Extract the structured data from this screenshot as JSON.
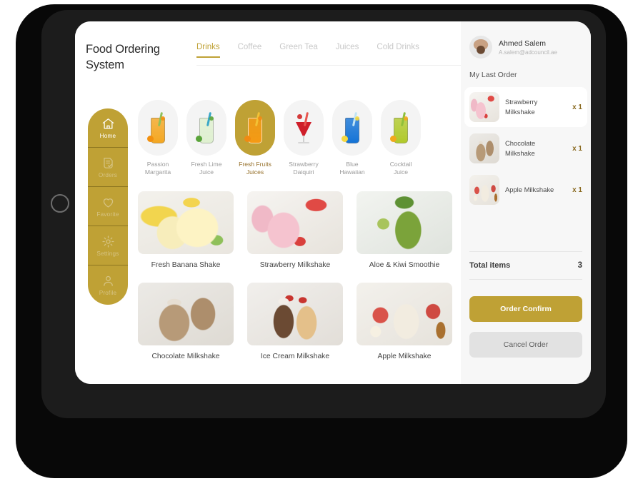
{
  "app": {
    "title": "Food Ordering\nSystem",
    "title_line1": "Food Ordering",
    "title_line2": "System"
  },
  "colors": {
    "accent_gold": "#BFA135",
    "accent_gold_text": "#96702A",
    "panel_bg": "#F7F7F7",
    "button_cancel_bg": "#E2E2E2",
    "frame_dark": "#1C1C1C"
  },
  "tabs": [
    {
      "label": "Drinks",
      "active": true
    },
    {
      "label": "Coffee",
      "active": false
    },
    {
      "label": "Green Tea",
      "active": false
    },
    {
      "label": "Juices",
      "active": false
    },
    {
      "label": "Cold Drinks",
      "active": false
    }
  ],
  "sidebar": {
    "items": [
      {
        "label": "Home",
        "icon": "home-icon",
        "active": true
      },
      {
        "label": "Orders",
        "icon": "document-check-icon",
        "active": false
      },
      {
        "label": "Favorite",
        "icon": "heart-icon",
        "active": false
      },
      {
        "label": "Settings",
        "icon": "gear-icon",
        "active": false
      },
      {
        "label": "Profile",
        "icon": "person-icon",
        "active": false
      }
    ]
  },
  "categories": [
    {
      "label_line1": "Passion",
      "label_line2": "Margarita",
      "active": false,
      "glyph": "orange-cocktail-glass"
    },
    {
      "label_line1": "Fresh Lime",
      "label_line2": "Juice",
      "active": false,
      "glyph": "mojito-glass"
    },
    {
      "label_line1": "Fresh Fruits",
      "label_line2": "Juices",
      "active": true,
      "glyph": "orange-juice-glass"
    },
    {
      "label_line1": "Strawberry",
      "label_line2": "Daiquiri",
      "active": false,
      "glyph": "red-cocktail-glass"
    },
    {
      "label_line1": "Blue",
      "label_line2": "Hawaiian",
      "active": false,
      "glyph": "blue-drink-glass"
    },
    {
      "label_line1": "Cocktail",
      "label_line2": "Juice",
      "active": false,
      "glyph": "green-cocktail-glass"
    }
  ],
  "products": [
    {
      "name": "Fresh Banana Shake",
      "photo": "ph-banana"
    },
    {
      "name": "Strawberry Milkshake",
      "photo": "ph-strawberry"
    },
    {
      "name": "Aloe & Kiwi Smoothie",
      "photo": "ph-kiwi"
    },
    {
      "name": "Chocolate Milkshake",
      "photo": "ph-chocolate"
    },
    {
      "name": "Ice Cream Milkshake",
      "photo": "ph-icecream"
    },
    {
      "name": "Apple Milkshake",
      "photo": "ph-apple"
    }
  ],
  "user": {
    "name": "Ahmed Salem",
    "email": "A.salem@adcouncil.ae"
  },
  "order_panel": {
    "section_title": "My Last Order",
    "items": [
      {
        "name": "Strawberry Milkshake",
        "qty": "x 1",
        "photo": "ph-strawberry",
        "highlight": true
      },
      {
        "name": "Chocolate Milkshake",
        "qty": "x 1",
        "photo": "ph-chocolate",
        "highlight": false
      },
      {
        "name": "Apple Milkshake",
        "qty": "x 1",
        "photo": "ph-apple",
        "highlight": false
      }
    ],
    "total_label": "Total items",
    "total_value": "3",
    "confirm_label": "Order Confirm",
    "cancel_label": "Cancel Order"
  }
}
